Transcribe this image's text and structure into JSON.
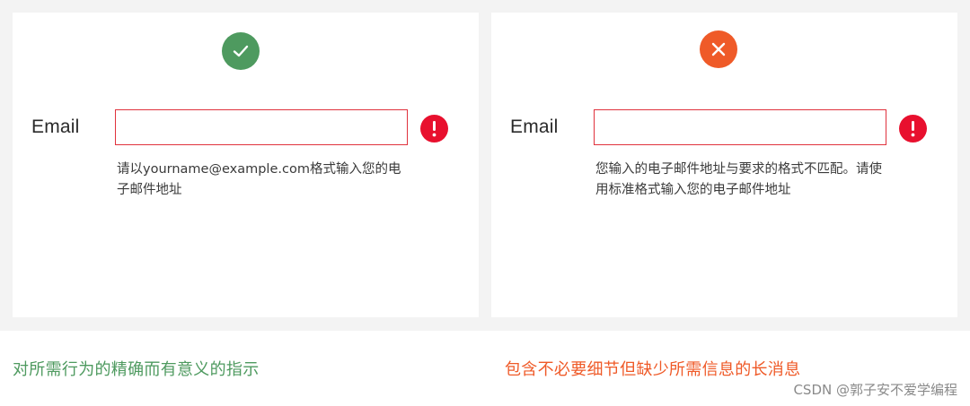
{
  "good_example": {
    "status_icon": "checkmark-icon",
    "field_label": "Email",
    "field_value": "",
    "error_icon": "exclamation-icon",
    "helper_text": "请以yourname@example.com格式输入您的电子邮件地址",
    "caption": "对所需行为的精确而有意义的指示"
  },
  "bad_example": {
    "status_icon": "cross-icon",
    "field_label": "Email",
    "field_value": "",
    "error_icon": "exclamation-icon",
    "helper_text": "您输入的电子邮件地址与要求的格式不匹配。请使用标准格式输入您的电子邮件地址",
    "caption": "包含不必要细节但缺少所需信息的长消息"
  },
  "watermark": "CSDN @郭子安不爱学编程",
  "colors": {
    "good": "#4e9a5f",
    "bad": "#ef5a28",
    "error": "#e8102e",
    "input_border": "#e0323d"
  }
}
